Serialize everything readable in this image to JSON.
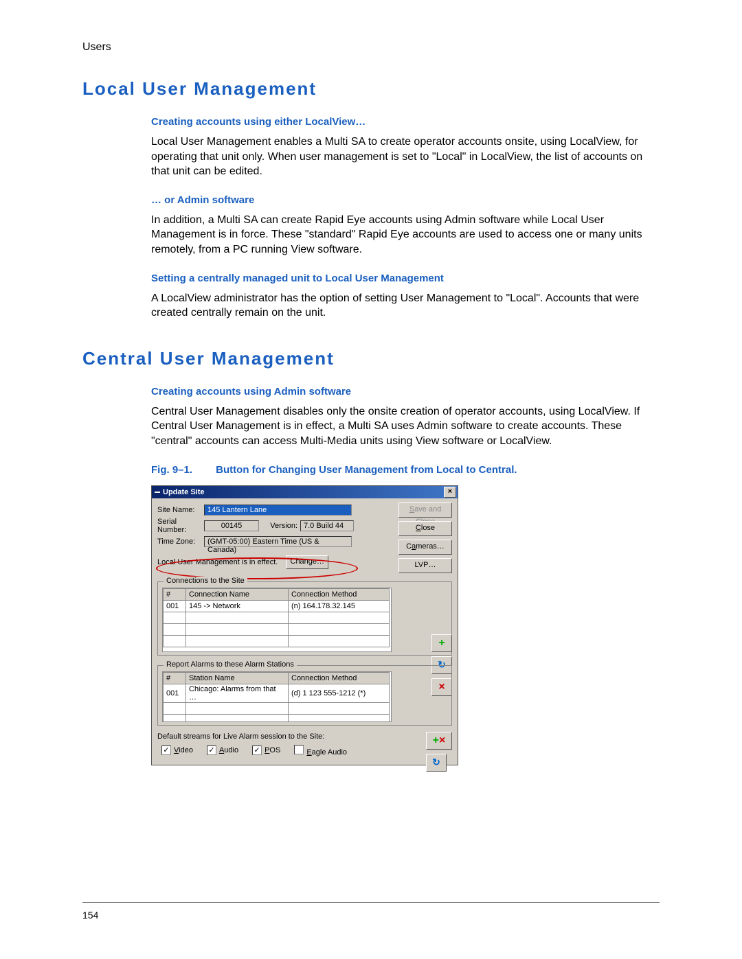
{
  "breadcrumb": "Users",
  "page_number": "154",
  "section1": {
    "title": "Local User Management",
    "sub1": "Creating accounts using either LocalView…",
    "p1": "Local User Management enables a Multi SA to create operator accounts onsite, using LocalView, for operating that unit only. When user management is set to \"Local\" in LocalView, the list of accounts on that unit can be edited.",
    "sub2": "… or Admin software",
    "p2": "In addition,  a Multi SA can create Rapid Eye accounts using Admin software while Local User Management is in force. These \"standard\" Rapid Eye accounts are used to access one or many units remotely, from a PC running View software.",
    "sub3": "Setting a centrally managed unit to Local User Management",
    "p3": "A LocalView administrator has the option of setting User Management to \"Local\". Accounts that were created centrally remain on the unit."
  },
  "section2": {
    "title": "Central User Management",
    "sub1": "Creating accounts using Admin software",
    "p1": "Central User Management disables only the onsite creation of operator accounts, using LocalView. If Central User Management is in effect, a Multi SA uses Admin software to create accounts. These \"central\" accounts can access Multi-Media units using View software or LocalView.",
    "fig_no": "Fig. 9–1.",
    "fig_caption": "Button for Changing User Management from Local to Central."
  },
  "dialog": {
    "title": "Update Site",
    "labels": {
      "site_name": "Site Name:",
      "serial": "Serial Number:",
      "version": "Version:",
      "timezone": "Time Zone:",
      "mgmt_status": "Local User Management is in effect.",
      "connections_legend": "Connections to the Site",
      "alarms_legend": "Report Alarms to these Alarm Stations",
      "default_streams": "Default streams for Live Alarm session to the Site:"
    },
    "values": {
      "site_name": "145 Lantern Lane",
      "serial": "00145",
      "version": "7.0 Build 44",
      "timezone": "(GMT-05:00) Eastern Time (US & Canada)"
    },
    "buttons": {
      "save_close": "Save and Close",
      "close": "Close",
      "cameras": "Cameras…",
      "lvp": "LVP…",
      "change": "Change…"
    },
    "conn_table": {
      "headers": {
        "num": "#",
        "name": "Connection Name",
        "method": "Connection Method"
      },
      "rows": [
        {
          "num": "001",
          "name": "145 -> Network",
          "method": "(n) 164.178.32.145"
        }
      ]
    },
    "alarm_table": {
      "headers": {
        "num": "#",
        "name": "Station Name",
        "method": "Connection Method"
      },
      "rows": [
        {
          "num": "001",
          "name": "Chicago: Alarms from that …",
          "method": "(d) 1 123 555-1212 (*)"
        }
      ]
    },
    "checks": {
      "video": "Video",
      "audio": "Audio",
      "pos": "POS",
      "eagle": "Eagle Audio"
    }
  }
}
